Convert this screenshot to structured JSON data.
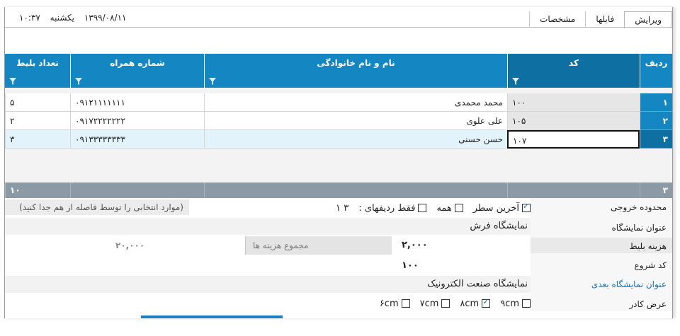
{
  "header": {
    "time": "۱۰:۳۷",
    "weekday": "یکشنبه",
    "date": "۱۳۹۹/۰۸/۱۱",
    "tabs": [
      {
        "label": "ویرایش",
        "active": true
      },
      {
        "label": "فایلها",
        "active": false
      },
      {
        "label": "مشخصات",
        "active": false
      }
    ]
  },
  "grid": {
    "columns": [
      "ردیف",
      "کد",
      "نام و نام خانوادگی",
      "شماره همراه",
      "تعداد بلیط"
    ],
    "rows": [
      {
        "row": "۱",
        "code": "۱۰۰",
        "name": "محمد محمدی",
        "phone": "۰۹۱۲۱۱۱۱۱۱۱",
        "tickets": "۵"
      },
      {
        "row": "۲",
        "code": "۱۰۵",
        "name": "علی علوی",
        "phone": "۰۹۱۷۲۲۲۲۲۲۲",
        "tickets": "۲"
      },
      {
        "row": "۳",
        "code": "۱۰۷",
        "name": "حسن حسنی",
        "phone": "۰۹۱۳۳۳۳۳۳۳۳",
        "tickets": "۳"
      }
    ],
    "footer": {
      "row_count": "۳",
      "tickets_total": "۱۰"
    }
  },
  "form": {
    "labels": {
      "output_range": "محدوده خروجی",
      "exhibition_title": "عنوان نمایشگاه",
      "ticket_cost": "هزینه بلیط",
      "start_code": "کد شروع",
      "next_exhibition_title": "عنوان نمایشگاه بعدی",
      "frame_width": "عرض کادر"
    },
    "range_options": {
      "last_row": "آخرین سطر",
      "all": "همه",
      "rows_only": "فقط ردیفهای :",
      "rows_value": "۳ ۱",
      "hint": "(موارد انتخابی را توسط فاصله از هم جدا کنید)"
    },
    "exhibition_title_value": "نمایشگاه فرش",
    "ticket_cost_value": "۲,۰۰۰",
    "total_cost_label": "مجموع هزینه ها",
    "total_cost_value": "۲۰,۰۰۰",
    "start_code_value": "۱۰۰",
    "next_exhibition_value": "نمایشگاه صنعت الکترونیک",
    "widths": [
      {
        "label": "۹cm",
        "checked": false
      },
      {
        "label": "۸cm",
        "checked": true
      },
      {
        "label": "۷cm",
        "checked": false
      },
      {
        "label": "۶cm",
        "checked": false
      }
    ]
  },
  "colors": {
    "header_blue": "#1486c2",
    "selected_blue": "#0e6fa3",
    "footer_gray": "#8b9aa5"
  }
}
